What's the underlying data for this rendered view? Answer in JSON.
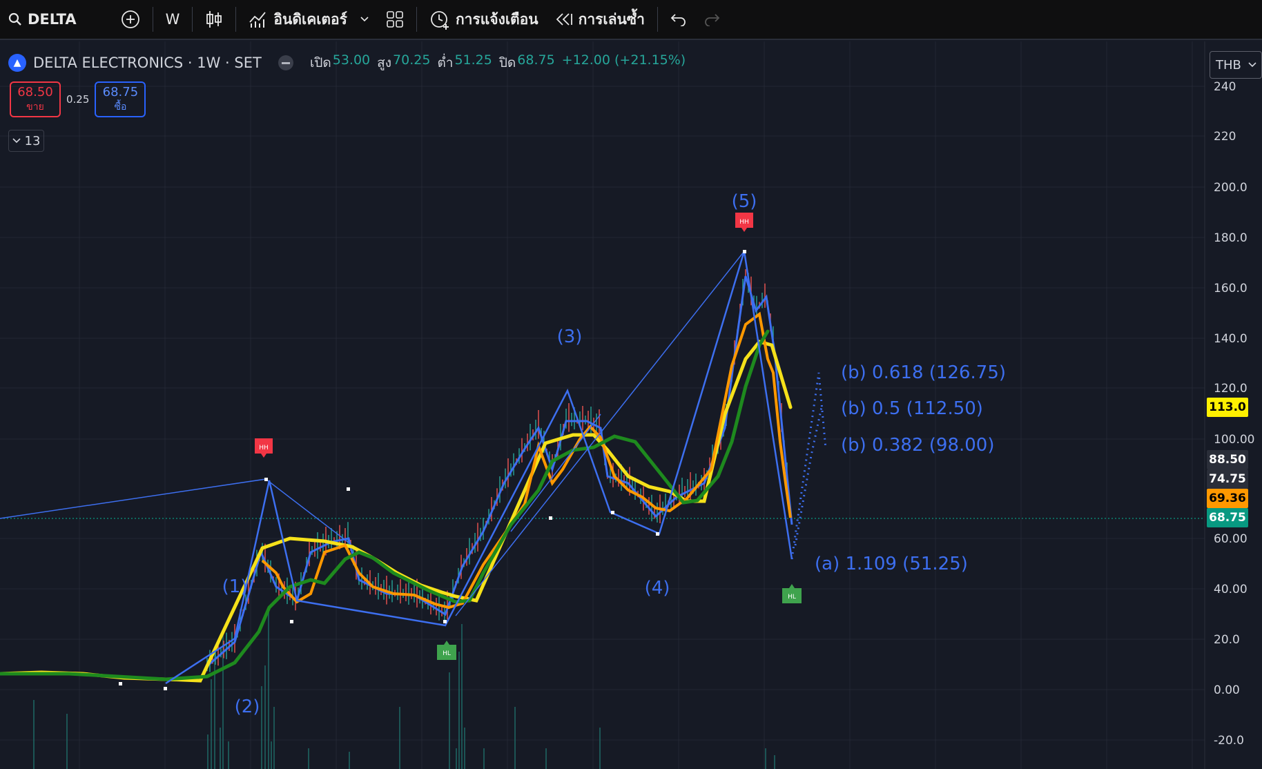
{
  "toolbar": {
    "symbol": "DELTA",
    "interval": "W",
    "indicators_label": "อินดิเคเตอร์",
    "alert_label": "การแจ้งเตือน",
    "replay_label": "การเล่นซ้ำ"
  },
  "legend": {
    "title": "DELTA ELECTRONICS · 1W · SET",
    "open_label": "เปิด",
    "open": "53.00",
    "high_label": "สูง",
    "high": "70.25",
    "low_label": "ต่ำ",
    "low": "51.25",
    "close_label": "ปิด",
    "close": "68.75",
    "change": "+12.00 (+21.15%)"
  },
  "bidask": {
    "sell_price": "68.50",
    "sell_label": "ขาย",
    "spread": "0.25",
    "buy_price": "68.75",
    "buy_label": "ซื้อ"
  },
  "collapse": {
    "count": "13"
  },
  "price_scale": {
    "currency": "THB",
    "ticks": [
      "240",
      "220",
      "200.0",
      "180.0",
      "160.0",
      "140.0",
      "120.0",
      "100.00",
      "60.00",
      "40.00",
      "20.0",
      "0.00",
      "-20.0"
    ],
    "tags": [
      {
        "label": "113.0",
        "bg": "#fff000",
        "fg": "#000000"
      },
      {
        "label": "88.50",
        "bg": "#2a2e39",
        "fg": "#ffffff"
      },
      {
        "label": "74.75",
        "bg": "#2a2e39",
        "fg": "#ffffff"
      },
      {
        "label": "69.36",
        "bg": "#ff9800",
        "fg": "#000000"
      },
      {
        "label": "68.75",
        "bg": "#089981",
        "fg": "#ffffff"
      }
    ]
  },
  "waves": {
    "w1": "(1)",
    "w2": "(2)",
    "w3": "(3)",
    "w4": "(4)",
    "w5": "(5)",
    "fib_618": "(b) 0.618 (126.75)",
    "fib_5": "(b) 0.5 (112.50)",
    "fib_382": "(b) 0.382 (98.00)",
    "a_label": "(a) 1.109 (51.25)",
    "hh": "HH",
    "hl": "HL"
  },
  "colors": {
    "wave_blue": "#3d6ff0",
    "ma_yellow": "#f5e11a",
    "ma_orange": "#ff9800",
    "ma_green": "#1e8a1e",
    "hh_red": "#f23645",
    "hl_green": "#3fa34d"
  }
}
